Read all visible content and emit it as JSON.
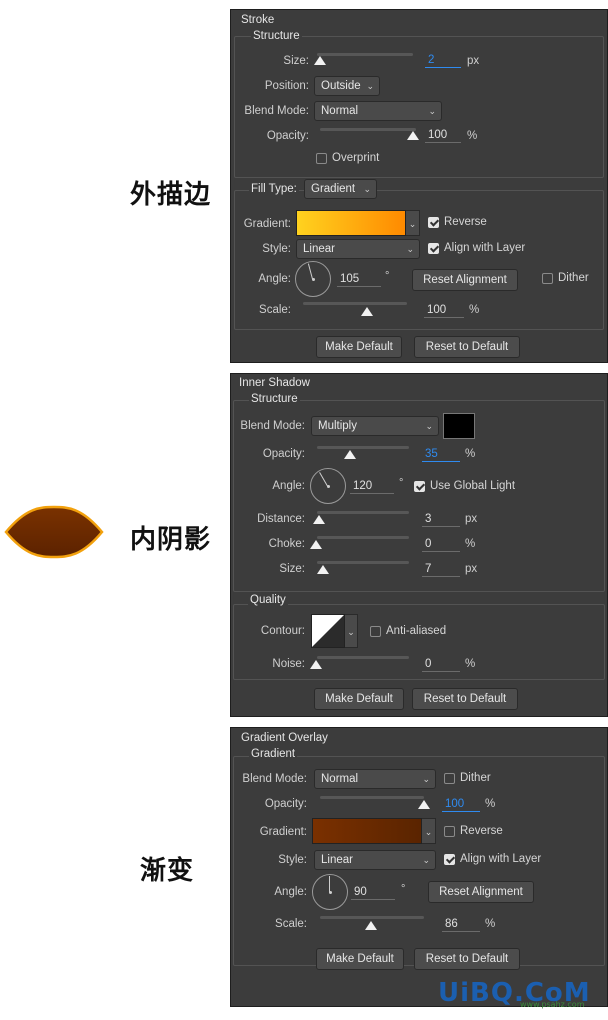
{
  "labels_cjk": {
    "stroke": "外描边",
    "inner_shadow": "内阴影",
    "gradient": "渐变"
  },
  "stroke": {
    "title": "Stroke",
    "structure": "Structure",
    "size_label": "Size:",
    "size_value": "2",
    "size_unit": "px",
    "size_pct": 0,
    "position_label": "Position:",
    "position_value": "Outside",
    "blend_label": "Blend Mode:",
    "blend_value": "Normal",
    "opacity_label": "Opacity:",
    "opacity_value": "100",
    "opacity_unit": "%",
    "opacity_pct": 100,
    "overprint": "Overprint",
    "fill_type_label": "Fill Type:",
    "fill_type_value": "Gradient",
    "gradient_label": "Gradient:",
    "gradient_colors": [
      "#ffd21f",
      "#ff8a00"
    ],
    "reverse": "Reverse",
    "style_label": "Style:",
    "style_value": "Linear",
    "align": "Align with Layer",
    "angle_label": "Angle:",
    "angle_value": "105",
    "degree": "°",
    "reset_alignment": "Reset Alignment",
    "dither": "Dither",
    "scale_label": "Scale:",
    "scale_value": "100",
    "scale_unit": "%",
    "scale_pct": 62,
    "make_default": "Make Default",
    "reset_default": "Reset to Default"
  },
  "inner_shadow": {
    "title": "Inner Shadow",
    "structure": "Structure",
    "blend_label": "Blend Mode:",
    "blend_value": "Multiply",
    "blend_color": "#000000",
    "opacity_label": "Opacity:",
    "opacity_value": "35",
    "opacity_unit": "%",
    "opacity_pct": 35,
    "angle_label": "Angle:",
    "angle_value": "120",
    "degree": "°",
    "global_light": "Use Global Light",
    "distance_label": "Distance:",
    "distance_value": "3",
    "distance_unit": "px",
    "distance_pct": 3,
    "choke_label": "Choke:",
    "choke_value": "0",
    "choke_unit": "%",
    "choke_pct": 0,
    "size_label": "Size:",
    "size_value": "7",
    "size_unit": "px",
    "size_pct": 5,
    "quality": "Quality",
    "contour_label": "Contour:",
    "anti_aliased": "Anti-aliased",
    "noise_label": "Noise:",
    "noise_value": "0",
    "noise_unit": "%",
    "noise_pct": 0,
    "make_default": "Make Default",
    "reset_default": "Reset to Default"
  },
  "gradient_overlay": {
    "title": "Gradient Overlay",
    "subtitle": "Gradient",
    "blend_label": "Blend Mode:",
    "blend_value": "Normal",
    "dither": "Dither",
    "opacity_label": "Opacity:",
    "opacity_value": "100",
    "opacity_unit": "%",
    "opacity_pct": 100,
    "gradient_label": "Gradient:",
    "gradient_colors": [
      "#7a3000",
      "#5a2400"
    ],
    "reverse": "Reverse",
    "style_label": "Style:",
    "style_value": "Linear",
    "align": "Align with Layer",
    "angle_label": "Angle:",
    "angle_value": "90",
    "degree": "°",
    "reset_alignment": "Reset Alignment",
    "scale_label": "Scale:",
    "scale_value": "86",
    "scale_unit": "%",
    "scale_pct": 50,
    "make_default": "Make Default",
    "reset_default": "Reset to Default"
  },
  "watermark": "UiBQ.CoM",
  "watermark_sub": "www.psahz.com"
}
